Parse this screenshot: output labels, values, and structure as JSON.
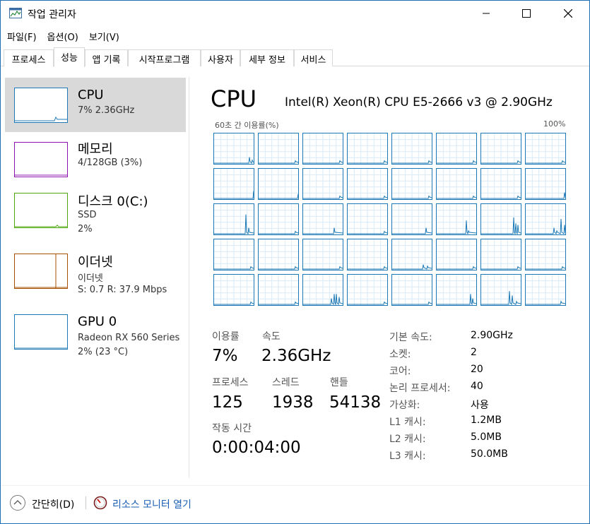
{
  "window": {
    "title": "작업 관리자"
  },
  "menu": [
    "파일(F)",
    "옵션(O)",
    "보기(V)"
  ],
  "tabs": [
    "프로세스",
    "성능",
    "앱 기록",
    "시작프로그램",
    "사용자",
    "세부 정보",
    "서비스"
  ],
  "active_tab": "성능",
  "sidebar": [
    {
      "title": "CPU",
      "lines": [
        "7% 2.36GHz"
      ],
      "color": "#1c79b5",
      "active": true
    },
    {
      "title": "메모리",
      "lines": [
        "4/128GB (3%)"
      ],
      "color": "#8b12ae",
      "active": false
    },
    {
      "title": "디스크 0(C:)",
      "lines": [
        "SSD",
        "2%"
      ],
      "color": "#4da60c",
      "active": false
    },
    {
      "title": "이더넷",
      "lines": [
        "이더넷",
        "S: 0.7  R: 37.9 Mbps"
      ],
      "color": "#a74f01",
      "active": false
    },
    {
      "title": "GPU 0",
      "lines": [
        "Radeon RX 560 Series",
        "2% (23 °C)"
      ],
      "color": "#1c79b5",
      "active": false
    }
  ],
  "cpu": {
    "heading": "CPU",
    "model": "Intel(R) Xeon(R) CPU E5-2666 v3 @ 2.90GHz",
    "graph_label_left": "60초 간 이용률(%)",
    "graph_label_right": "100%",
    "core_count": 40,
    "accent": "#1c79b5",
    "grid_color": "#d9eaf7"
  },
  "stats": {
    "utilization_label": "이용률",
    "utilization_value": "7%",
    "speed_label": "속도",
    "speed_value": "2.36GHz",
    "processes_label": "프로세스",
    "processes_value": "125",
    "threads_label": "스레드",
    "threads_value": "1938",
    "handles_label": "핸들",
    "handles_value": "54138",
    "uptime_label": "작동 시간",
    "uptime_value": "0:00:04:00"
  },
  "details": [
    {
      "label": "기본 속도:",
      "value": "2.90GHz"
    },
    {
      "label": "소켓:",
      "value": "2"
    },
    {
      "label": "코어:",
      "value": "20"
    },
    {
      "label": "논리 프로세서:",
      "value": "40"
    },
    {
      "label": "가상화:",
      "value": "사용"
    },
    {
      "label": "L1 캐시:",
      "value": "1.2MB"
    },
    {
      "label": "L2 캐시:",
      "value": "5.0MB"
    },
    {
      "label": "L3 캐시:",
      "value": "50.0MB"
    }
  ],
  "footer": {
    "collapse_label": "간단히(D)",
    "monitor_label": "리소스 모니터 열기"
  }
}
